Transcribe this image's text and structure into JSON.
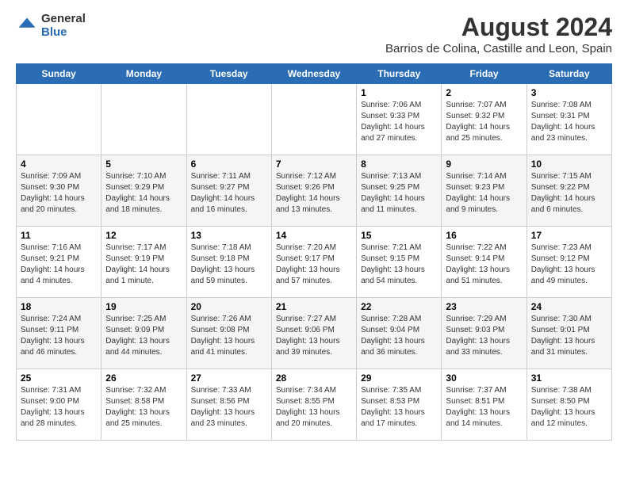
{
  "logo": {
    "general": "General",
    "blue": "Blue"
  },
  "title": "August 2024",
  "subtitle": "Barrios de Colina, Castille and Leon, Spain",
  "weekdays": [
    "Sunday",
    "Monday",
    "Tuesday",
    "Wednesday",
    "Thursday",
    "Friday",
    "Saturday"
  ],
  "weeks": [
    [
      {
        "day": "",
        "info": ""
      },
      {
        "day": "",
        "info": ""
      },
      {
        "day": "",
        "info": ""
      },
      {
        "day": "",
        "info": ""
      },
      {
        "day": "1",
        "info": "Sunrise: 7:06 AM\nSunset: 9:33 PM\nDaylight: 14 hours\nand 27 minutes."
      },
      {
        "day": "2",
        "info": "Sunrise: 7:07 AM\nSunset: 9:32 PM\nDaylight: 14 hours\nand 25 minutes."
      },
      {
        "day": "3",
        "info": "Sunrise: 7:08 AM\nSunset: 9:31 PM\nDaylight: 14 hours\nand 23 minutes."
      }
    ],
    [
      {
        "day": "4",
        "info": "Sunrise: 7:09 AM\nSunset: 9:30 PM\nDaylight: 14 hours\nand 20 minutes."
      },
      {
        "day": "5",
        "info": "Sunrise: 7:10 AM\nSunset: 9:29 PM\nDaylight: 14 hours\nand 18 minutes."
      },
      {
        "day": "6",
        "info": "Sunrise: 7:11 AM\nSunset: 9:27 PM\nDaylight: 14 hours\nand 16 minutes."
      },
      {
        "day": "7",
        "info": "Sunrise: 7:12 AM\nSunset: 9:26 PM\nDaylight: 14 hours\nand 13 minutes."
      },
      {
        "day": "8",
        "info": "Sunrise: 7:13 AM\nSunset: 9:25 PM\nDaylight: 14 hours\nand 11 minutes."
      },
      {
        "day": "9",
        "info": "Sunrise: 7:14 AM\nSunset: 9:23 PM\nDaylight: 14 hours\nand 9 minutes."
      },
      {
        "day": "10",
        "info": "Sunrise: 7:15 AM\nSunset: 9:22 PM\nDaylight: 14 hours\nand 6 minutes."
      }
    ],
    [
      {
        "day": "11",
        "info": "Sunrise: 7:16 AM\nSunset: 9:21 PM\nDaylight: 14 hours\nand 4 minutes."
      },
      {
        "day": "12",
        "info": "Sunrise: 7:17 AM\nSunset: 9:19 PM\nDaylight: 14 hours\nand 1 minute."
      },
      {
        "day": "13",
        "info": "Sunrise: 7:18 AM\nSunset: 9:18 PM\nDaylight: 13 hours\nand 59 minutes."
      },
      {
        "day": "14",
        "info": "Sunrise: 7:20 AM\nSunset: 9:17 PM\nDaylight: 13 hours\nand 57 minutes."
      },
      {
        "day": "15",
        "info": "Sunrise: 7:21 AM\nSunset: 9:15 PM\nDaylight: 13 hours\nand 54 minutes."
      },
      {
        "day": "16",
        "info": "Sunrise: 7:22 AM\nSunset: 9:14 PM\nDaylight: 13 hours\nand 51 minutes."
      },
      {
        "day": "17",
        "info": "Sunrise: 7:23 AM\nSunset: 9:12 PM\nDaylight: 13 hours\nand 49 minutes."
      }
    ],
    [
      {
        "day": "18",
        "info": "Sunrise: 7:24 AM\nSunset: 9:11 PM\nDaylight: 13 hours\nand 46 minutes."
      },
      {
        "day": "19",
        "info": "Sunrise: 7:25 AM\nSunset: 9:09 PM\nDaylight: 13 hours\nand 44 minutes."
      },
      {
        "day": "20",
        "info": "Sunrise: 7:26 AM\nSunset: 9:08 PM\nDaylight: 13 hours\nand 41 minutes."
      },
      {
        "day": "21",
        "info": "Sunrise: 7:27 AM\nSunset: 9:06 PM\nDaylight: 13 hours\nand 39 minutes."
      },
      {
        "day": "22",
        "info": "Sunrise: 7:28 AM\nSunset: 9:04 PM\nDaylight: 13 hours\nand 36 minutes."
      },
      {
        "day": "23",
        "info": "Sunrise: 7:29 AM\nSunset: 9:03 PM\nDaylight: 13 hours\nand 33 minutes."
      },
      {
        "day": "24",
        "info": "Sunrise: 7:30 AM\nSunset: 9:01 PM\nDaylight: 13 hours\nand 31 minutes."
      }
    ],
    [
      {
        "day": "25",
        "info": "Sunrise: 7:31 AM\nSunset: 9:00 PM\nDaylight: 13 hours\nand 28 minutes."
      },
      {
        "day": "26",
        "info": "Sunrise: 7:32 AM\nSunset: 8:58 PM\nDaylight: 13 hours\nand 25 minutes."
      },
      {
        "day": "27",
        "info": "Sunrise: 7:33 AM\nSunset: 8:56 PM\nDaylight: 13 hours\nand 23 minutes."
      },
      {
        "day": "28",
        "info": "Sunrise: 7:34 AM\nSunset: 8:55 PM\nDaylight: 13 hours\nand 20 minutes."
      },
      {
        "day": "29",
        "info": "Sunrise: 7:35 AM\nSunset: 8:53 PM\nDaylight: 13 hours\nand 17 minutes."
      },
      {
        "day": "30",
        "info": "Sunrise: 7:37 AM\nSunset: 8:51 PM\nDaylight: 13 hours\nand 14 minutes."
      },
      {
        "day": "31",
        "info": "Sunrise: 7:38 AM\nSunset: 8:50 PM\nDaylight: 13 hours\nand 12 minutes."
      }
    ]
  ]
}
